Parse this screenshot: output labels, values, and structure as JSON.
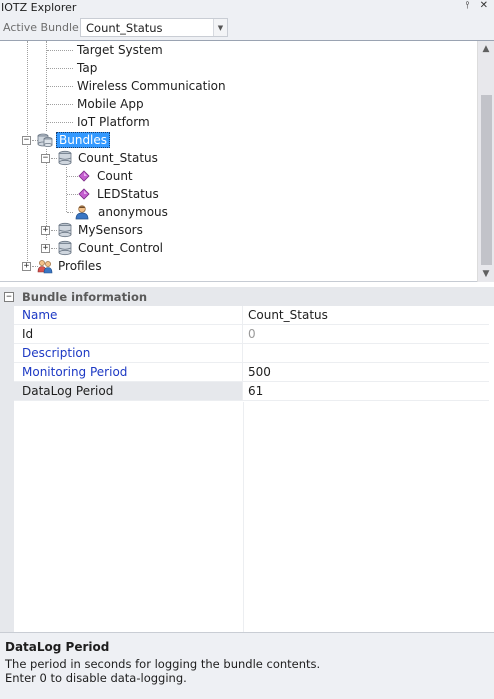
{
  "window": {
    "title": "IOTZ Explorer",
    "pin_icon": "pin-icon",
    "close_icon": "close-icon"
  },
  "toolbar": {
    "active_bundle_label": "Active Bundle:",
    "active_bundle_value": "Count_Status"
  },
  "tree": {
    "items": [
      {
        "label": "Target System",
        "icon": "none"
      },
      {
        "label": "Tap",
        "icon": "none"
      },
      {
        "label": "Wireless Communication",
        "icon": "none"
      },
      {
        "label": "Mobile App",
        "icon": "none"
      },
      {
        "label": "IoT Platform",
        "icon": "none"
      },
      {
        "label": "Bundles",
        "icon": "bundles-icon",
        "expanded": true,
        "selected": true
      },
      {
        "label": "Count_Status",
        "icon": "bundle-icon",
        "expanded": true
      },
      {
        "label": "Count",
        "icon": "variable-icon"
      },
      {
        "label": "LEDStatus",
        "icon": "variable-icon"
      },
      {
        "label": "anonymous",
        "icon": "user-icon"
      },
      {
        "label": "MySensors",
        "icon": "bundle-icon",
        "expanded": false
      },
      {
        "label": "Count_Control",
        "icon": "bundle-icon",
        "expanded": false
      },
      {
        "label": "Profiles",
        "icon": "profiles-icon",
        "expanded": false
      }
    ]
  },
  "property_grid": {
    "category": "Bundle information",
    "rows": [
      {
        "name": "Name",
        "value": "Count_Status"
      },
      {
        "name": "Id",
        "value": "0"
      },
      {
        "name": "Description",
        "value": ""
      },
      {
        "name": "Monitoring Period",
        "value": "500"
      },
      {
        "name": "DataLog Period",
        "value": "61"
      }
    ]
  },
  "help": {
    "title": "DataLog Period",
    "lines": [
      "The period in seconds for logging the bundle contents.",
      "Enter 0 to disable data-logging."
    ]
  },
  "colors": {
    "selection": "#3399ff",
    "property_name_blue": "#1d39c4",
    "panel_bg": "#eef0f4"
  }
}
